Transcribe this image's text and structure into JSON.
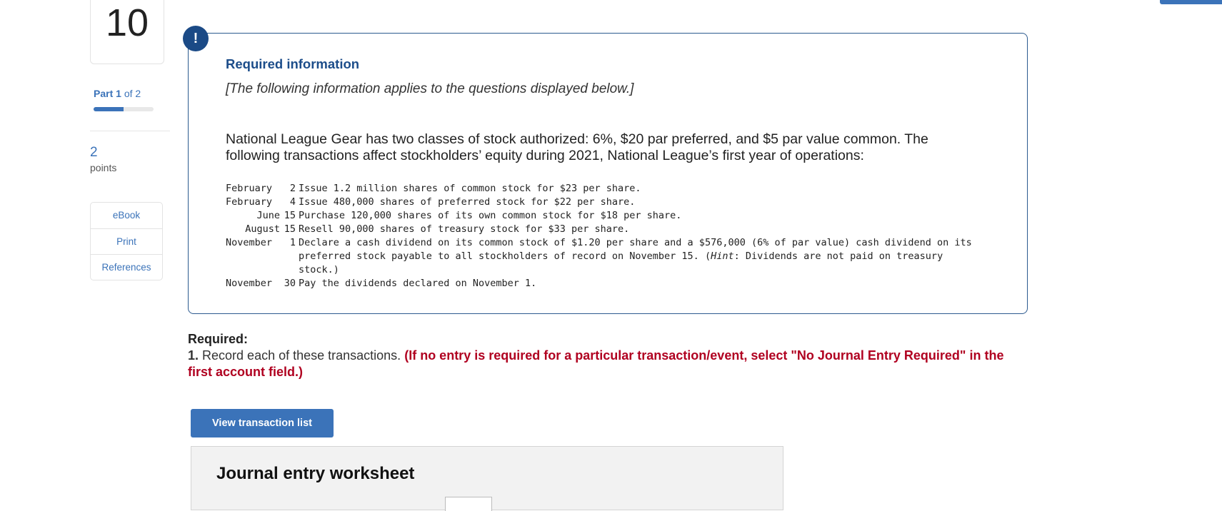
{
  "question": {
    "number": "10"
  },
  "part": {
    "prefix": "Part",
    "current": "1",
    "of_text": "of 2",
    "progress": 0.5
  },
  "points": {
    "value": "2",
    "label": "points"
  },
  "tools": [
    "eBook",
    "Print",
    "References"
  ],
  "info": {
    "alert_symbol": "!",
    "title": "Required information",
    "note": "[The following information applies to the questions displayed below.]",
    "intro": "National League Gear has two classes of stock authorized: 6%, $20 par preferred, and $5 par value common. The following transactions affect stockholders’ equity during 2021, National League’s first year of operations:",
    "transactions": [
      {
        "month": "February",
        "day": "2",
        "desc": "Issue 1.2 million shares of common stock for $23 per share."
      },
      {
        "month": "February",
        "day": "4",
        "desc": "Issue 480,000 shares of preferred stock for $22 per share."
      },
      {
        "month": "June",
        "day": "15",
        "desc": "Purchase 120,000 shares of its own common stock for $18 per share."
      },
      {
        "month": "August",
        "day": "15",
        "desc": "Resell 90,000 shares of treasury stock for $33 per share."
      },
      {
        "month": "November",
        "day": "1",
        "desc_before": "Declare a cash dividend on its common stock of $1.20 per share and a $576,000 (6% of par value) cash dividend on its preferred stock payable to all stockholders of record on November 15. (",
        "desc_hint": "Hint",
        "desc_after": ": Dividends are not paid on treasury stock.)"
      },
      {
        "month": "November",
        "day": "30",
        "desc": "Pay the dividends declared on November 1."
      }
    ]
  },
  "required": {
    "heading": "Required:",
    "item_number": "1.",
    "item_text": "Record each of these transactions.",
    "item_hint": "(If no entry is required for a particular transaction/event, select \"No Journal Entry Required\" in the first account field.)"
  },
  "buttons": {
    "view_transaction_list": "View transaction list"
  },
  "worksheet": {
    "title": "Journal entry worksheet"
  },
  "colors": {
    "accent": "#3b73b9",
    "card_border": "#2c5a8f",
    "hint_red": "#b00020",
    "alert_bg": "#1b4a86"
  }
}
